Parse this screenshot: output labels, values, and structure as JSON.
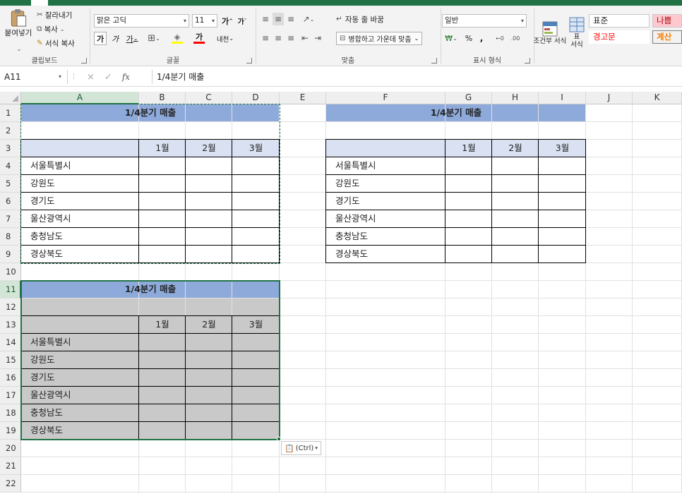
{
  "ribbon": {
    "clipboard": {
      "paste": "붙여넣기",
      "cut": "잘라내기",
      "copy": "복사",
      "format_painter": "서식 복사",
      "label": "클립보드"
    },
    "font": {
      "name": "맑은 고딕",
      "size": "11",
      "bold": "가",
      "italic": "가",
      "underline": "가",
      "phonetic": "내천",
      "label": "글꼴"
    },
    "alignment": {
      "wrap_text": "자동 줄 바꿈",
      "merge_center": "병합하고 가운데 맞춤",
      "label": "맞춤"
    },
    "number": {
      "format": "일반",
      "percent": "%",
      "comma": ",",
      "label": "표시 형식"
    },
    "styles": {
      "conditional": "조건부 서식",
      "conditional_sub": "서식",
      "table": "표",
      "table_sub": "서식",
      "normal": "표준",
      "bad": "나쁨",
      "warning": "경고문",
      "calc": "계산"
    },
    "colors": {
      "accent": "#217346",
      "header_fill": "#8eaadb",
      "subheader_fill": "#d9e1f2",
      "gray_fill": "#c9c9c9",
      "bad_fill": "#ffc7ce",
      "bad_text": "#9c0006",
      "warning_text": "#ff0000",
      "calc_fill": "#f2f2f2",
      "calc_text": "#fa7d00"
    }
  },
  "formula_bar": {
    "name_box": "A11",
    "cancel": "×",
    "enter": "✓",
    "fx": "fx",
    "content": "1/4분기 매출"
  },
  "sheet": {
    "columns": [
      "A",
      "B",
      "C",
      "D",
      "E",
      "F",
      "G",
      "H",
      "I",
      "J",
      "K"
    ],
    "rows": [
      "1",
      "2",
      "3",
      "4",
      "5",
      "6",
      "7",
      "8",
      "9",
      "10",
      "11",
      "12",
      "13",
      "14",
      "15",
      "16",
      "17",
      "18",
      "19",
      "20",
      "21",
      "22"
    ],
    "title": "1/4분기 매출",
    "months": [
      "1월",
      "2월",
      "3월"
    ],
    "regions": [
      "서울특별시",
      "강원도",
      "경기도",
      "울산광역시",
      "충청남도",
      "경상북도"
    ],
    "selected_cell": "A11",
    "paste_options_label": "(Ctrl)"
  }
}
